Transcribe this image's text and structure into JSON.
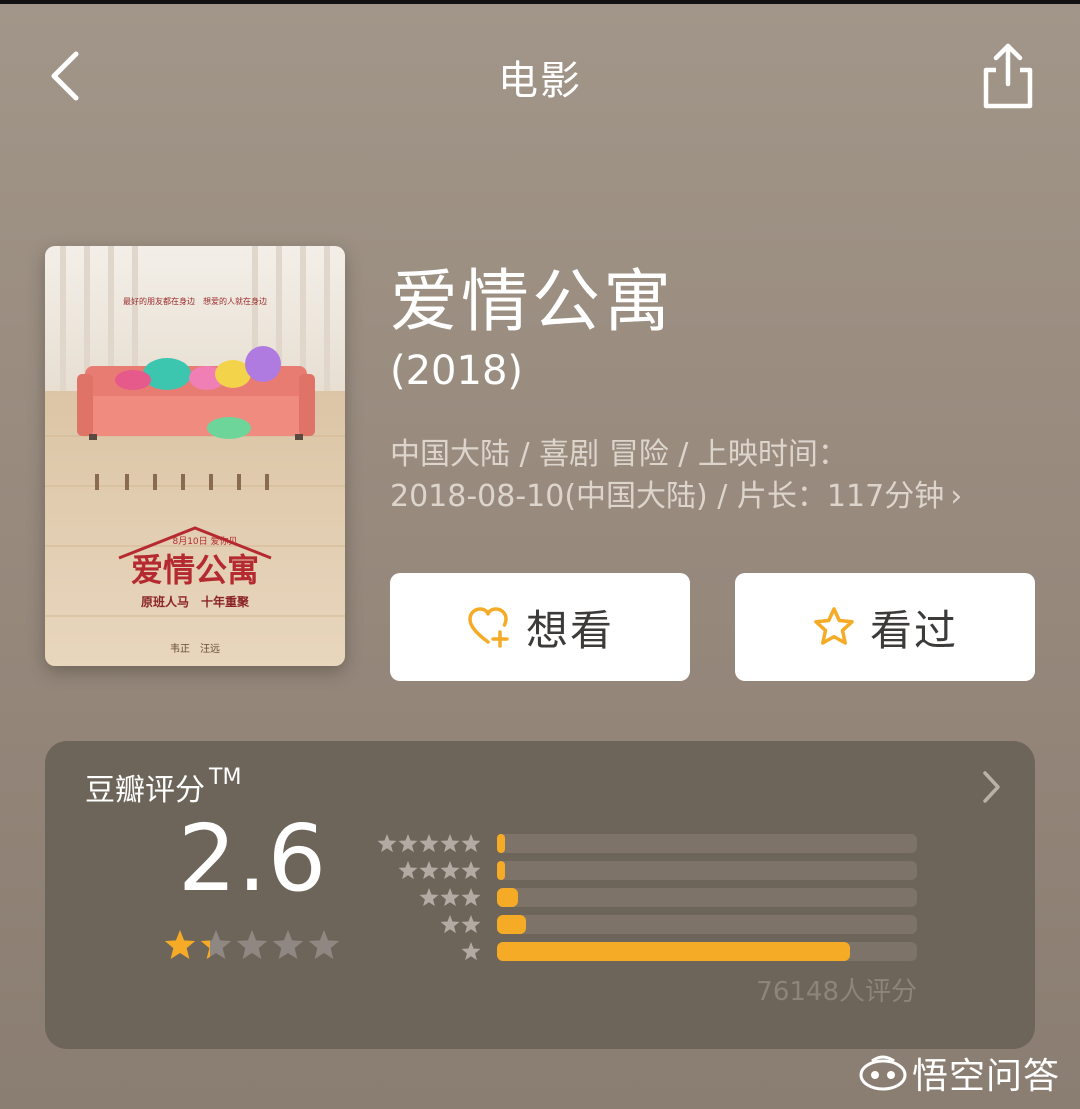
{
  "nav": {
    "title": "电影",
    "back_icon": "chevron-left-icon",
    "share_icon": "share-icon"
  },
  "movie": {
    "title": "爱情公寓",
    "year": "(2018)",
    "meta_line1": "中国大陆 / 喜剧 冒险 / 上映时间：",
    "meta_line2": "2018-08-10(中国大陆) / 片长：117分钟",
    "meta_arrow": "›",
    "poster": {
      "tagline": "最好的朋友都在身边　想爱的人就在身边",
      "title": "爱情公寓",
      "subtitle": "原班人马　十年重聚",
      "release_badge": "8月10日 爱你见",
      "credits": "韦正　汪远"
    }
  },
  "actions": {
    "want_label": "想看",
    "seen_label": "看过",
    "want_icon": "heart-plus-icon",
    "seen_icon": "star-outline-icon"
  },
  "rating": {
    "label": "豆瓣评分",
    "tm": "TM",
    "score": "2.6",
    "star_level": 1.3,
    "count_text": "76148人评分",
    "distribution": [
      {
        "stars": 5,
        "fraction": 0.02
      },
      {
        "stars": 4,
        "fraction": 0.02
      },
      {
        "stars": 3,
        "fraction": 0.05
      },
      {
        "stars": 2,
        "fraction": 0.07
      },
      {
        "stars": 1,
        "fraction": 0.84
      }
    ]
  },
  "watermark": {
    "text": "悟空问答",
    "icon": "logo-icon"
  },
  "colors": {
    "accent": "#f6ab27",
    "star_empty": "#8f8882",
    "card_bg": "#6d645a"
  }
}
